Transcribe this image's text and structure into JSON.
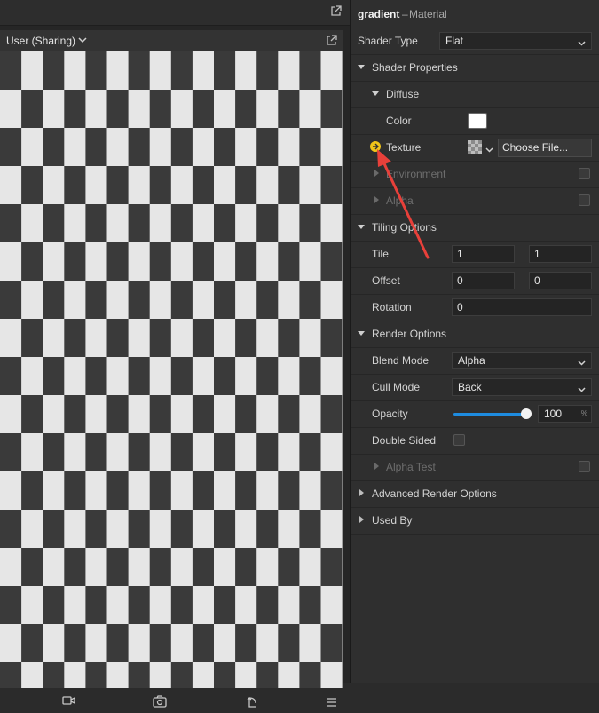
{
  "left_panel": {
    "viewport_title": "User (Sharing)",
    "icons": [
      "external-link-icon",
      "chevron-down-icon",
      "video-icon",
      "screenshot-icon",
      "rotate-icon",
      "menu-icon"
    ]
  },
  "inspector": {
    "asset_name": "gradient",
    "separator": "–",
    "asset_type": "Material",
    "shader_type": {
      "label": "Shader Type",
      "value": "Flat"
    },
    "shader_properties": {
      "label": "Shader Properties",
      "diffuse": {
        "label": "Diffuse",
        "color_label": "Color",
        "color_value": "#ffffff",
        "texture_label": "Texture",
        "choose_file": "Choose File..."
      },
      "environment_label": "Environment",
      "alpha_label": "Alpha"
    },
    "tiling": {
      "label": "Tiling Options",
      "tile_label": "Tile",
      "tile_x": "1",
      "tile_y": "1",
      "offset_label": "Offset",
      "offset_x": "0",
      "offset_y": "0",
      "rotation_label": "Rotation",
      "rotation": "0"
    },
    "render": {
      "label": "Render Options",
      "blend_mode_label": "Blend Mode",
      "blend_mode": "Alpha",
      "cull_mode_label": "Cull Mode",
      "cull_mode": "Back",
      "opacity_label": "Opacity",
      "opacity": "100",
      "opacity_unit": "%",
      "opacity_fraction": 1.0,
      "double_sided_label": "Double Sided",
      "alpha_test_label": "Alpha Test"
    },
    "advanced_label": "Advanced Render Options",
    "used_by_label": "Used By"
  },
  "colors": {
    "accent": "#1e8ce0",
    "annotation_arrow": "#e8403a",
    "hint_dot": "#f0c419",
    "panel": "#2f2f2f"
  }
}
